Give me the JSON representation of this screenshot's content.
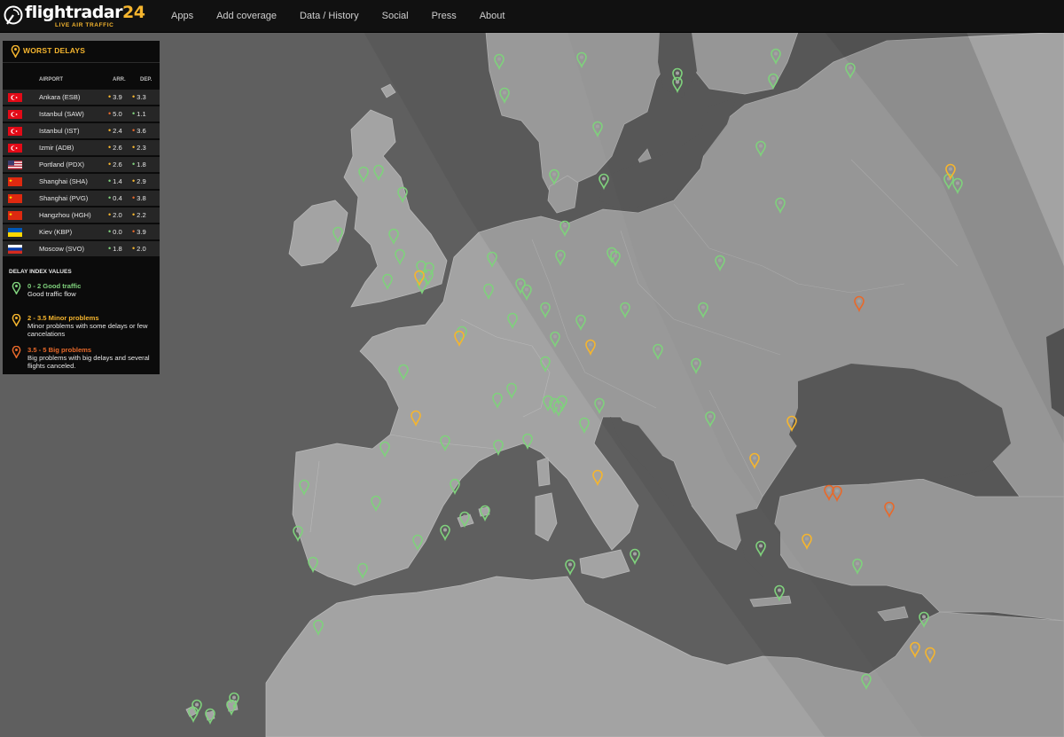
{
  "header": {
    "logo_text": "flightradar",
    "logo_number": "24",
    "logo_tagline": "LIVE AIR TRAFFIC",
    "nav": [
      {
        "label": "Apps"
      },
      {
        "label": "Add coverage"
      },
      {
        "label": "Data / History"
      },
      {
        "label": "Social"
      },
      {
        "label": "Press"
      },
      {
        "label": "About"
      }
    ]
  },
  "delays": {
    "title": "WORST DELAYS",
    "col_airport": "AIRPORT",
    "col_arr": "ARR.",
    "col_dep": "DEP.",
    "rows": [
      {
        "country": "turkey",
        "airport": "Ankara (ESB)",
        "arr": "3.9",
        "arr_status": "minor",
        "dep": "3.3",
        "dep_status": "minor"
      },
      {
        "country": "turkey",
        "airport": "Istanbul (SAW)",
        "arr": "5.0",
        "arr_status": "big",
        "dep": "1.1",
        "dep_status": "good"
      },
      {
        "country": "turkey",
        "airport": "Istanbul (IST)",
        "arr": "2.4",
        "arr_status": "minor",
        "dep": "3.6",
        "dep_status": "big"
      },
      {
        "country": "turkey",
        "airport": "Izmir (ADB)",
        "arr": "2.6",
        "arr_status": "minor",
        "dep": "2.3",
        "dep_status": "minor"
      },
      {
        "country": "usa",
        "airport": "Portland (PDX)",
        "arr": "2.6",
        "arr_status": "minor",
        "dep": "1.8",
        "dep_status": "good"
      },
      {
        "country": "china",
        "airport": "Shanghai (SHA)",
        "arr": "1.4",
        "arr_status": "good",
        "dep": "2.9",
        "dep_status": "minor"
      },
      {
        "country": "china",
        "airport": "Shanghai (PVG)",
        "arr": "0.4",
        "arr_status": "good",
        "dep": "3.8",
        "dep_status": "big"
      },
      {
        "country": "china",
        "airport": "Hangzhou (HGH)",
        "arr": "2.0",
        "arr_status": "minor",
        "dep": "2.2",
        "dep_status": "minor"
      },
      {
        "country": "ukraine",
        "airport": "Kiev (KBP)",
        "arr": "0.0",
        "arr_status": "good",
        "dep": "3.9",
        "dep_status": "big"
      },
      {
        "country": "russia",
        "airport": "Moscow (SVO)",
        "arr": "1.8",
        "arr_status": "good",
        "dep": "2.0",
        "dep_status": "minor"
      }
    ],
    "legend_title": "DELAY INDEX VALUES",
    "legend": [
      {
        "status": "good",
        "label": "0 - 2 Good traffic",
        "desc": "Good traffic flow"
      },
      {
        "status": "minor",
        "label": "2 - 3.5 Minor problems",
        "desc": "Minor problems with some delays or few cancelations"
      },
      {
        "status": "big",
        "label": "3.5 - 5 Big problems",
        "desc": "Big problems with big delays and several flights canceled."
      }
    ]
  },
  "colors": {
    "good": "#7fd17c",
    "minor": "#f5b52e",
    "big": "#e8692a",
    "accent": "#f5b52e",
    "sea": "#5f5f5f",
    "land": "#a3a3a3"
  },
  "map_markers": {
    "good_count": 102,
    "minor_count": 14,
    "big_count": 5
  }
}
